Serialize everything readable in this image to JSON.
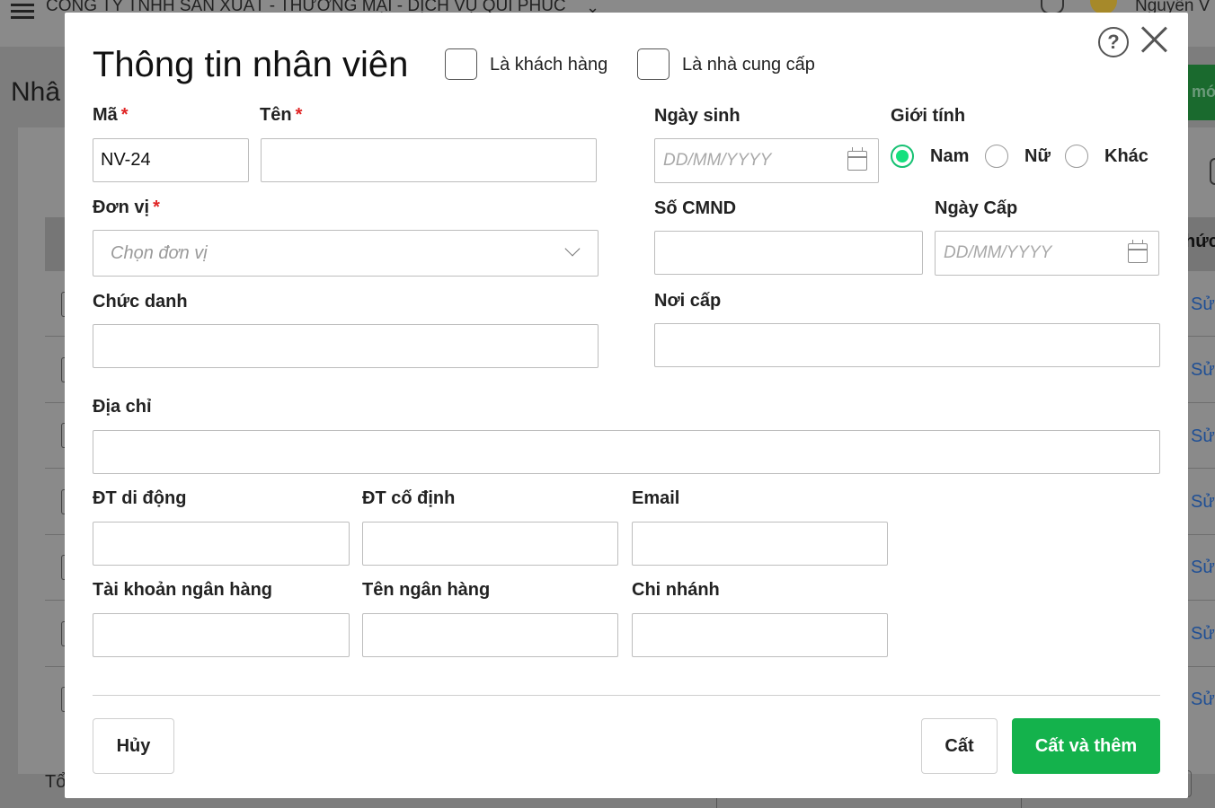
{
  "background": {
    "company_name": "CÔNG TY TNHH SẢN XUẤT - THƯƠNG MẠI - DỊCH VỤ QUI PHÚC",
    "user_name": "Nguyễn V",
    "page_title": "Nhâ",
    "add_button_label": "mớ",
    "column_header_partial": "hức",
    "edit_link_label": "Sử",
    "footer_text": "Tổ"
  },
  "dialog": {
    "title": "Thông tin nhân viên",
    "is_customer_label": "Là khách hàng",
    "is_supplier_label": "Là nhà cung cấp",
    "help_symbol": "?",
    "fields": {
      "ma_label": "Mã",
      "ma_value": "NV-24",
      "ten_label": "Tên",
      "ngay_sinh_label": "Ngày sinh",
      "gioi_tinh_label": "Giới tính",
      "gender_options": [
        "Nam",
        "Nữ",
        "Khác"
      ],
      "gender_selected": "Nam",
      "don_vi_label": "Đơn vị",
      "don_vi_placeholder": "Chọn đơn vị",
      "so_cmnd_label": "Số CMND",
      "ngay_cap_label": "Ngày Cấp",
      "chuc_danh_label": "Chức danh",
      "noi_cap_label": "Nơi cấp",
      "dia_chi_label": "Địa chỉ",
      "dt_di_dong_label": "ĐT di động",
      "dt_co_dinh_label": "ĐT cố định",
      "email_label": "Email",
      "tai_khoan_label": "Tài khoản ngân hàng",
      "ten_ngan_hang_label": "Tên ngân hàng",
      "chi_nhanh_label": "Chi nhánh",
      "date_placeholder": "DD/MM/YYYY",
      "required_mark": "*"
    },
    "buttons": {
      "cancel": "Hủy",
      "save": "Cất",
      "save_and_add": "Cất và thêm"
    },
    "colors": {
      "primary_green": "#14b24c",
      "required_red": "#e02424",
      "radio_green": "#16e07e"
    }
  }
}
